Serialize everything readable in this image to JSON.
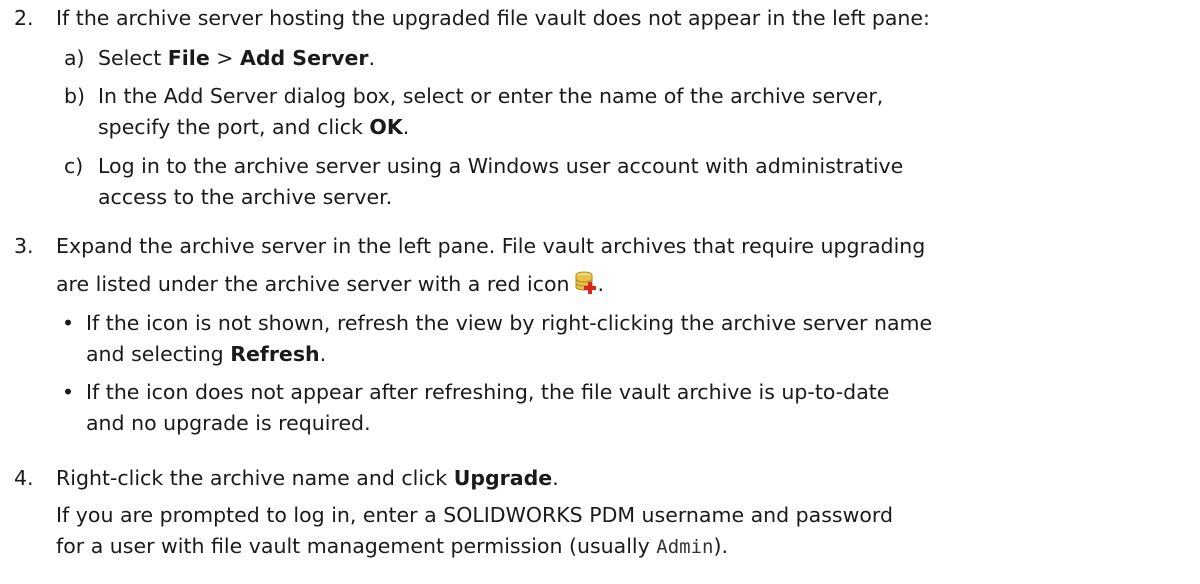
{
  "step2": {
    "num": "2.",
    "text": "If the archive server hosting the upgraded file vault does not appear in the left pane:",
    "a_label": "a)",
    "a_pre": "Select ",
    "a_file": "File",
    "a_sep": " > ",
    "a_add": "Add Server",
    "a_post": ".",
    "b_label": "b)",
    "b_line1": "In the Add Server dialog box, select or enter the name of the archive server,",
    "b_line2_pre": "specify the port, and click ",
    "b_ok": "OK",
    "b_post": ".",
    "c_label": "c)",
    "c_line1": "Log in to the archive server using a Windows user account with administrative",
    "c_line2": "access to the archive server."
  },
  "step3": {
    "num": "3.",
    "line1": "Expand the archive server in the left pane. File vault archives that require upgrading",
    "line2": "are listed under the archive server with a red icon",
    "line2_post": ".",
    "icon": "database-add-icon",
    "bullet1_line1": "If the icon is not shown, refresh the view by right-clicking the archive server name",
    "bullet1_line2_pre": "and selecting ",
    "bullet1_refresh": "Refresh",
    "bullet1_post": ".",
    "bullet2_line1": "If the icon does not appear after refreshing, the file vault archive is up-to-date",
    "bullet2_line2": "and no upgrade is required."
  },
  "step4": {
    "num": "4.",
    "line1_pre": "Right-click the archive name and click ",
    "line1_upgrade": "Upgrade",
    "line1_post": ".",
    "line2": "If you are prompted to log in, enter a SOLIDWORKS PDM username and password",
    "line3_pre": "for a user with file vault management permission (usually ",
    "line3_admin": "Admin",
    "line3_post": ")."
  },
  "colors": {
    "text": "#1a1a1a",
    "icon_db": "#e8c24a",
    "icon_plus": "#d9261c"
  }
}
